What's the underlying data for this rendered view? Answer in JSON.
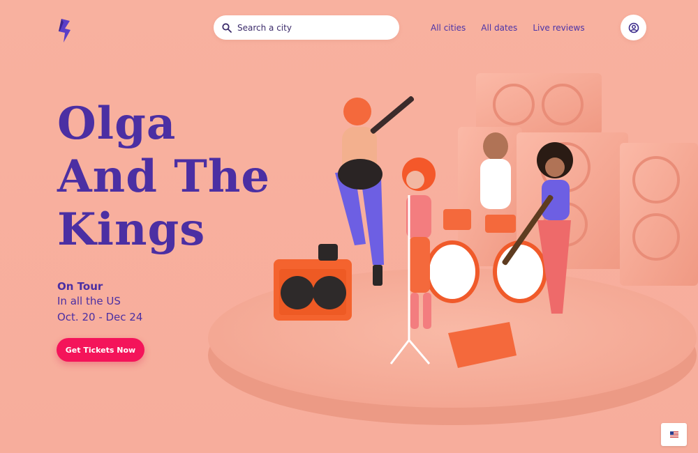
{
  "header": {
    "search_placeholder": "Search a city",
    "nav": [
      "All cities",
      "All dates",
      "Live reviews"
    ]
  },
  "hero": {
    "title_lines": [
      "Olga",
      "And The",
      "Kings"
    ],
    "subtitle": [
      "On Tour",
      "In all the US",
      "Oct. 20 - Dec 24"
    ],
    "cta_label": "Get Tickets Now"
  },
  "icons": {
    "logo": "lightning-logo",
    "search": "search-icon",
    "account": "user-icon",
    "flag": "us-flag-icon"
  },
  "colors": {
    "background": "#f8b19f",
    "primary": "#4b2fa3",
    "cta": "#f4145a"
  }
}
